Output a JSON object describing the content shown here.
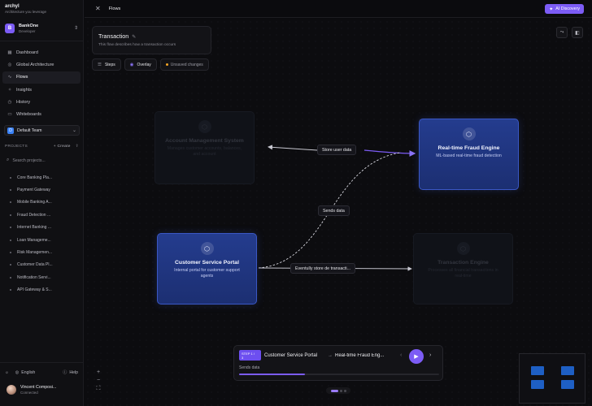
{
  "brand": {
    "name": "archyl",
    "tagline": "Architecture you leverage"
  },
  "org": {
    "initial": "B",
    "name": "BankOne",
    "role": "Developer"
  },
  "nav": [
    {
      "label": "Dashboard",
      "icon": "dashboard-icon",
      "glyph": "▦"
    },
    {
      "label": "Global Architecture",
      "icon": "globe-icon",
      "glyph": "◎"
    },
    {
      "label": "Flows",
      "icon": "flows-icon",
      "glyph": "∿"
    },
    {
      "label": "Insights",
      "icon": "lightbulb-icon",
      "glyph": "✧"
    },
    {
      "label": "History",
      "icon": "history-icon",
      "glyph": "◷"
    },
    {
      "label": "Whiteboards",
      "icon": "whiteboard-icon",
      "glyph": "▭"
    }
  ],
  "team": {
    "initial": "D",
    "name": "Default Team"
  },
  "projects": {
    "heading": "PROJECTS",
    "create_label": "+ Create",
    "search_placeholder": "Search projects...",
    "items": [
      "Core Banking Pla...",
      "Payment Gateway",
      "Mobile Banking A...",
      "Fraud Detection ...",
      "Internet Banking ...",
      "Loan Manageme...",
      "Risk Managemen...",
      "Customer Data Pl...",
      "Notification Servi...",
      "API Gateway & S..."
    ]
  },
  "footer": {
    "language": "English",
    "help": "Help"
  },
  "user": {
    "name": "Vincent Composi...",
    "status": "Connected"
  },
  "topbar": {
    "breadcrumb": "Flows",
    "ai_button": "AI Discovery"
  },
  "flow": {
    "title": "Transaction",
    "description": "This flow describes how a transaction occurs",
    "steps_label": "Steps",
    "overlay_label": "Overlay",
    "unsaved_label": "Unsaved changes"
  },
  "nodes": [
    {
      "id": "account",
      "title": "Account Management System",
      "desc": "Manages customer accounts, balances, and account",
      "active": false
    },
    {
      "id": "fraud",
      "title": "Real-time Fraud Engine",
      "desc": "ML-based real-time fraud detection",
      "active": true
    },
    {
      "id": "portal",
      "title": "Customer Service Portal",
      "desc": "Internal portal for customer support agents",
      "active": true
    },
    {
      "id": "txn",
      "title": "Transaction Engine",
      "desc": "Processes all financial transactions in real-time",
      "active": false
    }
  ],
  "edge_labels": {
    "store_user": "Store user data",
    "sends": "Sends data",
    "eventually": "Eventully store de transacti..."
  },
  "player": {
    "step_badge_line1": "STEP 1 /",
    "step_badge_line2": "3",
    "from": "Customer Service Portal",
    "arrow": "→",
    "to": "Real-time Fraud Eng...",
    "subtitle": "Sends data",
    "progress": 0.33
  },
  "colors": {
    "accent": "#7c5cf5",
    "node_active": "#243c8e",
    "minimap_node": "#1e5fc4"
  }
}
